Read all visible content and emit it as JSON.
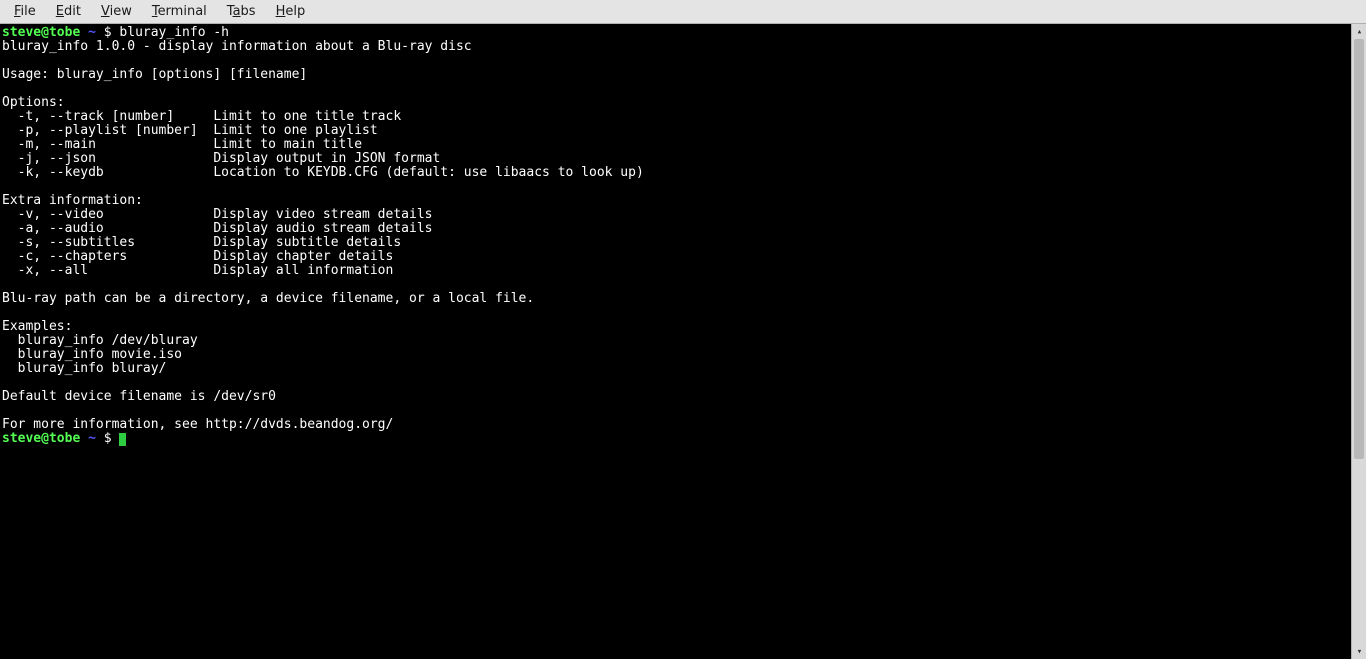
{
  "menubar": {
    "items": [
      "File",
      "Edit",
      "View",
      "Terminal",
      "Tabs",
      "Help"
    ]
  },
  "prompt": {
    "user_host": "steve@tobe",
    "path": "~",
    "symbol": "$"
  },
  "command1": "bluray_info -h",
  "output": {
    "line_title": "bluray_info 1.0.0 - display information about a Blu-ray disc",
    "blank1": "",
    "usage": "Usage: bluray_info [options] [filename]",
    "blank2": "",
    "options_header": "Options:",
    "opt_t": "  -t, --track [number]     Limit to one title track",
    "opt_p": "  -p, --playlist [number]  Limit to one playlist",
    "opt_m": "  -m, --main               Limit to main title",
    "opt_j": "  -j, --json               Display output in JSON format",
    "opt_k": "  -k, --keydb              Location to KEYDB.CFG (default: use libaacs to look up)",
    "blank3": "",
    "extra_header": "Extra information:",
    "opt_v": "  -v, --video              Display video stream details",
    "opt_a": "  -a, --audio              Display audio stream details",
    "opt_s": "  -s, --subtitles          Display subtitle details",
    "opt_c": "  -c, --chapters           Display chapter details",
    "opt_x": "  -x, --all                Display all information",
    "blank4": "",
    "path_note": "Blu-ray path can be a directory, a device filename, or a local file.",
    "blank5": "",
    "examples_header": "Examples:",
    "ex1": "  bluray_info /dev/bluray",
    "ex2": "  bluray_info movie.iso",
    "ex3": "  bluray_info bluray/",
    "blank6": "",
    "default_dev": "Default device filename is /dev/sr0",
    "blank7": "",
    "more_info": "For more information, see http://dvds.beandog.org/"
  }
}
